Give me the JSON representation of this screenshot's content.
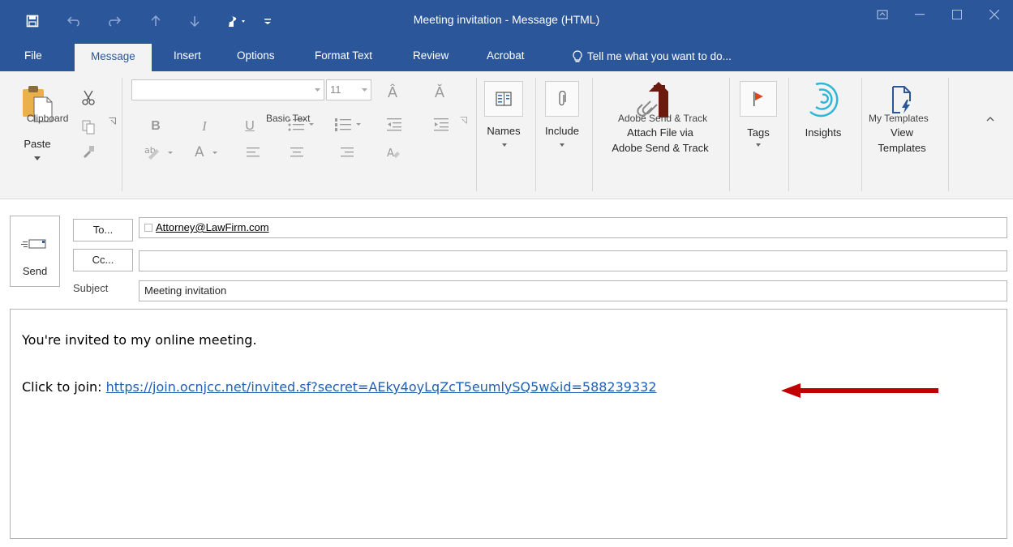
{
  "window": {
    "title": "Meeting invitation - Message (HTML)",
    "quick_access": [
      "save-icon",
      "undo-icon",
      "redo-icon",
      "up-arrow-icon",
      "down-arrow-icon",
      "touch-mode-icon",
      "customize-qat-icon"
    ]
  },
  "tabs": [
    {
      "label": "File"
    },
    {
      "label": "Message"
    },
    {
      "label": "Insert"
    },
    {
      "label": "Options"
    },
    {
      "label": "Format Text"
    },
    {
      "label": "Review"
    },
    {
      "label": "Acrobat"
    }
  ],
  "tell_me": "Tell me what you want to do...",
  "ribbon": {
    "clipboard": {
      "paste": "Paste",
      "group": "Clipboard"
    },
    "basic_text": {
      "font_size": "11",
      "group": "Basic Text"
    },
    "names": {
      "label": "Names"
    },
    "include": {
      "label": "Include"
    },
    "adobe": {
      "line1": "Attach File via",
      "line2": "Adobe Send & Track",
      "group": "Adobe Send & Track"
    },
    "tags": {
      "label": "Tags"
    },
    "insights": {
      "label": "Insights"
    },
    "templates": {
      "line1": "View",
      "line2": "Templates",
      "group": "My Templates"
    }
  },
  "compose": {
    "send_label": "Send",
    "to_button": "To...",
    "cc_button": "Cc...",
    "subject_label": "Subject",
    "to_value": "Attorney@LawFirm.com",
    "cc_value": "",
    "subject_value": "Meeting invitation"
  },
  "body": {
    "line1": "You're invited to my online meeting.",
    "join_prefix": "Click to join: ",
    "join_link": "https://join.ocnjcc.net/invited.sf?secret=AEky4oyLqZcT5eumlySQ5w&id=588239332"
  },
  "colors": {
    "titlebar": "#2b579a",
    "arrow": "#c00000",
    "link": "#1f5fb4"
  }
}
